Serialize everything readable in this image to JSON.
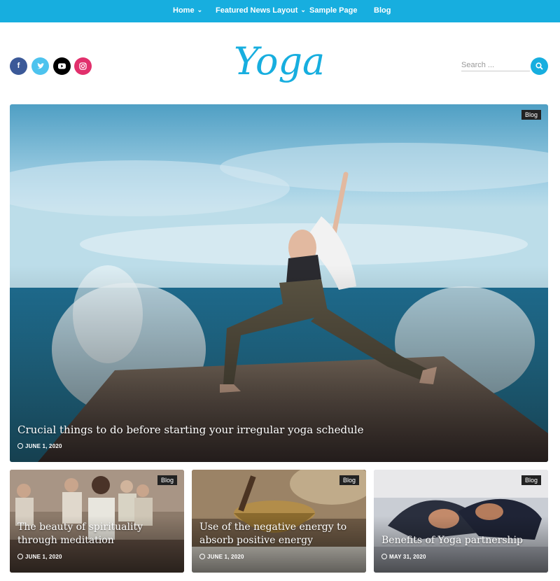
{
  "nav": {
    "items": [
      {
        "label": "Home",
        "has_dropdown": true
      },
      {
        "label": "Featured News Layout",
        "has_dropdown": true
      },
      {
        "label": "Sample Page",
        "has_dropdown": false
      },
      {
        "label": "Blog",
        "has_dropdown": false
      }
    ]
  },
  "header": {
    "logo_text": "Yoga",
    "social": [
      {
        "icon": "facebook-icon",
        "glyph": "f",
        "color": "#3b5998"
      },
      {
        "icon": "twitter-icon",
        "glyph": "t",
        "color": "#4dc3ee"
      },
      {
        "icon": "youtube-icon",
        "glyph": "▶",
        "color": "#000000"
      },
      {
        "icon": "instagram-icon",
        "glyph": "◎",
        "color": "#e1306c"
      }
    ],
    "search": {
      "placeholder": "Search ...",
      "icon": "search-icon"
    }
  },
  "featured": {
    "badge": "Blog",
    "title": "Crucial things to do before starting your irregular yoga schedule",
    "date": "JUNE 1, 2020"
  },
  "posts": [
    {
      "badge": "Blog",
      "title": "The beauty of spirituality through meditation",
      "date": "JUNE 1, 2020"
    },
    {
      "badge": "Blog",
      "title": "Use of the negative energy to absorb positive energy",
      "date": "JUNE 1, 2020"
    },
    {
      "badge": "Blog",
      "title": "Benefits of Yoga partnership",
      "date": "MAY 31, 2020"
    }
  ],
  "colors": {
    "accent": "#17aedf"
  }
}
